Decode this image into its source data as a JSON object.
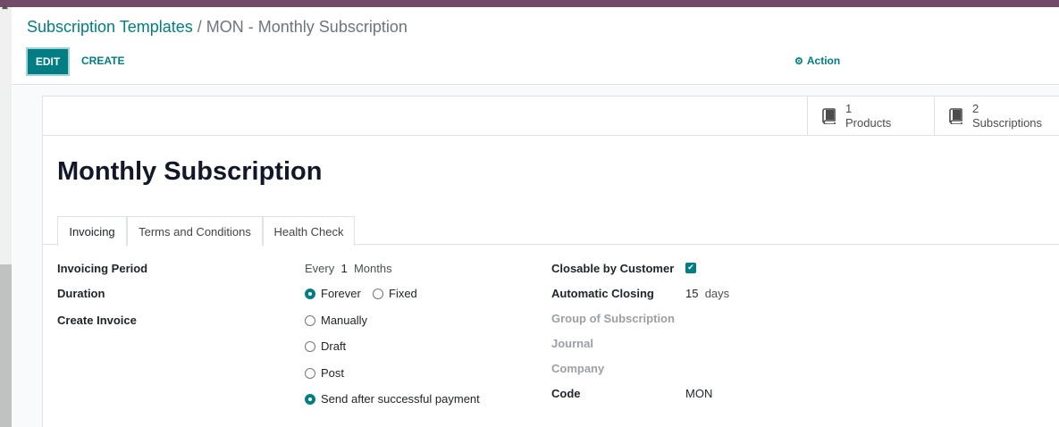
{
  "breadcrumb": {
    "parent": "Subscription Templates",
    "separator": " / ",
    "current": "MON - Monthly Subscription"
  },
  "toolbar": {
    "edit_label": "EDIT",
    "create_label": "CREATE",
    "action_label": "Action"
  },
  "stat_buttons": [
    {
      "count": "1",
      "label": "Products",
      "icon": "book-icon"
    },
    {
      "count": "2",
      "label": "Subscriptions",
      "icon": "book-icon"
    }
  ],
  "record": {
    "title": "Monthly Subscription"
  },
  "tabs": [
    {
      "label": "Invoicing",
      "active": true
    },
    {
      "label": "Terms and Conditions",
      "active": false
    },
    {
      "label": "Health Check",
      "active": false
    }
  ],
  "fields": {
    "invoicing_period": {
      "label": "Invoicing Period",
      "prefix": "Every",
      "number": "1",
      "unit": "Months"
    },
    "duration": {
      "label": "Duration",
      "options": [
        {
          "label": "Forever",
          "checked": true
        },
        {
          "label": "Fixed",
          "checked": false
        }
      ]
    },
    "create_invoice": {
      "label": "Create Invoice",
      "options": [
        {
          "label": "Manually",
          "checked": false
        },
        {
          "label": "Draft",
          "checked": false
        },
        {
          "label": "Post",
          "checked": false
        },
        {
          "label": "Send after successful payment",
          "checked": true
        }
      ]
    },
    "closable_by_customer": {
      "label": "Closable by Customer",
      "checked": true
    },
    "automatic_closing": {
      "label": "Automatic Closing",
      "number": "15",
      "unit": "days"
    },
    "group_of_subscription": {
      "label": "Group of Subscription"
    },
    "journal": {
      "label": "Journal"
    },
    "company": {
      "label": "Company"
    },
    "code": {
      "label": "Code",
      "value": "MON"
    }
  },
  "colors": {
    "brand_topbar": "#714b67",
    "accent": "#017e84"
  }
}
